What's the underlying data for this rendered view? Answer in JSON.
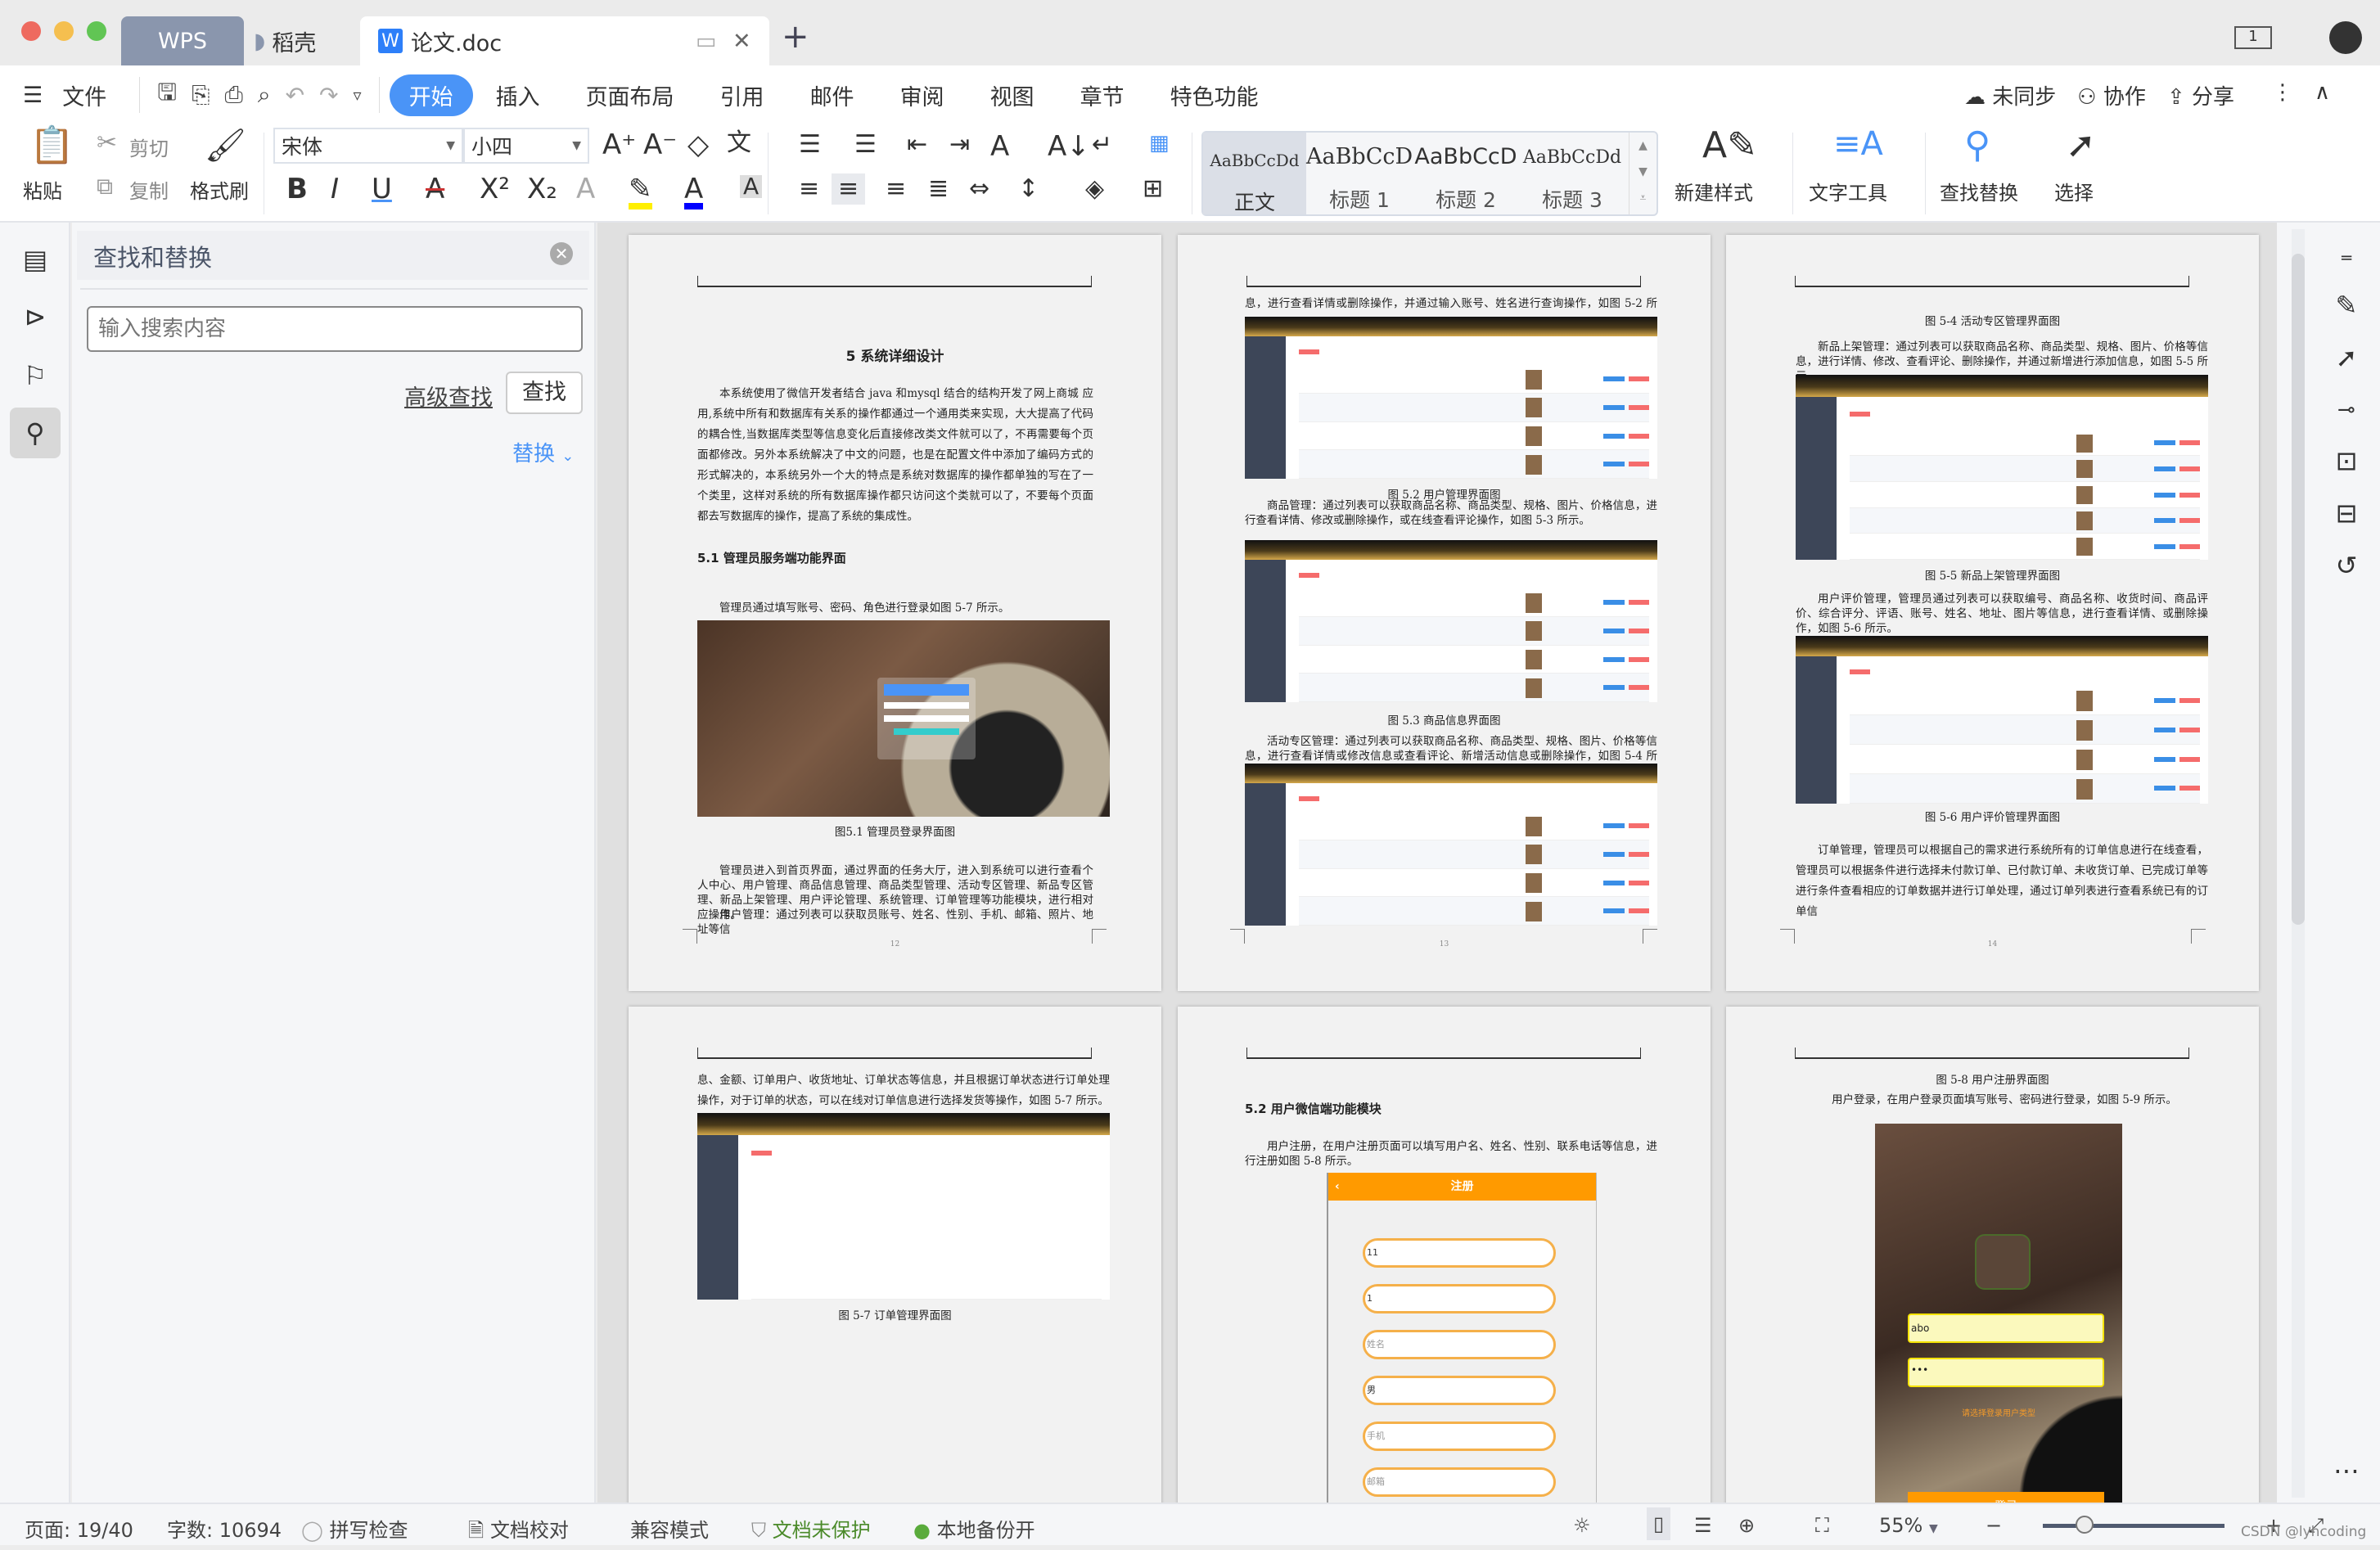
{
  "window": {
    "tabs": [
      {
        "label": "WPS"
      },
      {
        "label": "稻壳"
      },
      {
        "label": "论文.doc"
      }
    ],
    "new_tab": "+"
  },
  "menu": {
    "file": "文件",
    "items": [
      {
        "label": "开始",
        "active": true
      },
      {
        "label": "插入"
      },
      {
        "label": "页面布局"
      },
      {
        "label": "引用"
      },
      {
        "label": "邮件"
      },
      {
        "label": "审阅"
      },
      {
        "label": "视图"
      },
      {
        "label": "章节"
      },
      {
        "label": "特色功能"
      }
    ],
    "sync": "未同步",
    "collab": "协作",
    "share": "分享"
  },
  "ribbon": {
    "paste": "粘贴",
    "cut": "剪切",
    "copy": "复制",
    "format_painter": "格式刷",
    "font": "宋体",
    "size": "小四",
    "styles": [
      {
        "sample": "AaBbCcDd",
        "label": "正文"
      },
      {
        "sample": "AaBbCcD",
        "label": "标题 1"
      },
      {
        "sample": "AaBbCcD",
        "label": "标题 2"
      },
      {
        "sample": "AaBbCcDd",
        "label": "标题 3"
      }
    ],
    "new_style": "新建样式",
    "text_tools": "文字工具",
    "find_replace": "查找替换",
    "select": "选择"
  },
  "panel": {
    "title": "查找和替换",
    "search_placeholder": "输入搜索内容",
    "advanced": "高级查找",
    "find": "查找",
    "replace": "替换"
  },
  "pages": [
    {
      "number": "12",
      "title": "5 系统详细设计",
      "para1": "本系统使用了微信开发者结合 java 和mysql 结合的结构开发了网上商城 应用,系统中所有和数据库有关系的操作都通过一个通用类来实现，大大提高了代码的耦合性,当数据库类型等信息变化后直接修改类文件就可以了，不再需要每个页面都修改。另外本系统解决了中文的问题，也是在配置文件中添加了编码方式的形式解决的，本系统另外一个大的特点是系统对数据库的操作都单独的写在了一个类里，这样对系统的所有数据库操作都只访问这个类就可以了，不要每个页面都去写数据库的操作，提高了系统的集成性。",
      "h2": "5.1 管理员服务端功能界面",
      "para2": "管理员通过填写账号、密码、角色进行登录如图 5-7 所示。",
      "caption": "图5.1 管理员登录界面图",
      "para3": "管理员进入到首页界面，通过界面的任务大厅，进入到系统可以进行查看个人中心、用户管理、商品信息管理、商品类型管理、活动专区管理、新品专区管理、新品上架管理、用户评论管理、系统管理、订单管理等功能模块，进行相对应操作。",
      "para4": "用户管理：通过列表可以获取员账号、姓名、性别、手机、邮箱、照片、地址等信"
    },
    {
      "number": "13",
      "para1": "息，进行查看详情或删除操作，并通过输入账号、姓名进行查询操作，如图 5-2 所示。",
      "caption1": "图 5.2 用户管理界面图",
      "para2": "商品管理：通过列表可以获取商品名称、商品类型、规格、图片、价格信息，进行查看详情、修改或删除操作，或在线查看评论操作，如图 5-3 所示。",
      "caption2": "图 5.3 商品信息界面图",
      "para3": "活动专区管理：通过列表可以获取商品名称、商品类型、规格、图片、价格等信息，进行查看详情或修改信息或查看评论、新增活动信息或删除操作，如图 5-4 所示。"
    },
    {
      "number": "14",
      "caption1": "图 5-4 活动专区管理界面图",
      "para1": "新品上架管理：通过列表可以获取商品名称、商品类型、规格、图片、价格等信息，进行详情、修改、查看评论、删除操作，并通过新增进行添加信息，如图 5-5 所示。",
      "caption2": "图 5-5 新品上架管理界面图",
      "para2": "用户评价管理，管理员通过列表可以获取编号、商品名称、收货时间、商品评价、综合评分、评语、账号、姓名、地址、图片等信息，进行查看详情、或删除操作，如图 5-6 所示。",
      "caption3": "图 5-6 用户评价管理界面图",
      "para3": "订单管理，管理员可以根据自己的需求进行系统所有的订单信息进行在线查看，管理员可以根据条件进行选择未付款订单、已付款订单、未收货订单、已完成订单等进行条件查看相应的订单数据并进行订单处理，通过订单列表进行查看系统已有的订单信"
    },
    {
      "para1": "息、金额、订单用户、收货地址、订单状态等信息，并且根据订单状态进行订单处理操作，对于订单的状态，可以在线对订单信息进行选择发货等操作，如图 5-7 所示。",
      "caption": "图 5-7 订单管理界面图"
    },
    {
      "h2": "5.2 用户微信端功能模块",
      "para1": "用户注册，在用户注册页面可以填写用户名、姓名、性别、联系电话等信息，进行注册如图 5-8 所示。",
      "phone_title": "注册",
      "fields": [
        {
          "value": "11"
        },
        {
          "value": "1"
        },
        {
          "value": "姓名"
        },
        {
          "value": "男"
        },
        {
          "value": "手机"
        },
        {
          "value": "邮箱"
        }
      ]
    },
    {
      "caption": "图 5-8 用户注册界面图",
      "para1": "用户登录，在用户登录页面填写账号、密码进行登录，如图 5-9 所示。",
      "username": "abo",
      "password": "•••",
      "hint": "请选择登录用户类型",
      "login": "登录"
    }
  ],
  "status": {
    "page": "页面: 19/40",
    "words": "字数: 10694",
    "spell": "拼写检查",
    "proof": "文档校对",
    "compat": "兼容模式",
    "protect": "文档未保护",
    "backup": "本地备份开",
    "zoom": "55%",
    "watermark": "CSDN @lyhcoding"
  },
  "colors": {
    "accent": "#4a94f7",
    "orange": "#ff9a00",
    "green": "#5aab3c"
  }
}
